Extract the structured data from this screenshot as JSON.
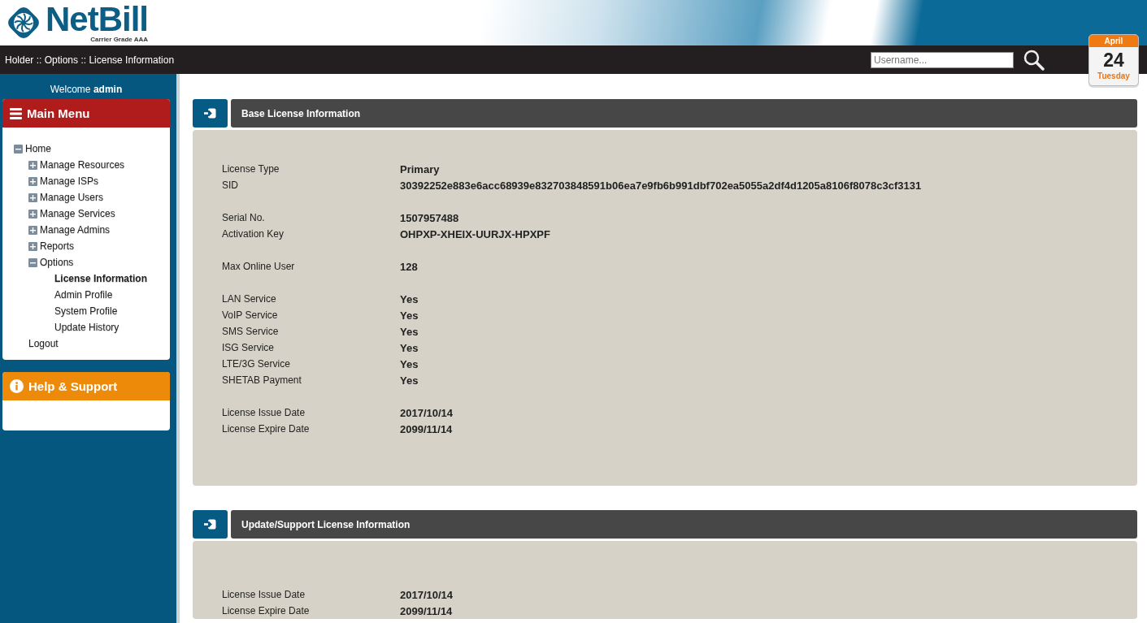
{
  "logo": {
    "name": "NetBill",
    "tagline": "Carrier Grade AAA"
  },
  "breadcrumb": "Holder :: Options :: License Information",
  "search": {
    "placeholder": "Username..."
  },
  "calendar": {
    "month": "April",
    "day": "24",
    "weekday": "Tuesday"
  },
  "sidebar": {
    "welcome": "Welcome **admin**",
    "main_menu": {
      "title": "Main Menu",
      "items": [
        {
          "label": "Home",
          "expanded": true,
          "selected": false,
          "children": [
            {
              "label": "Manage Resources",
              "expanded": false,
              "selected": false
            },
            {
              "label": "Manage ISPs",
              "expanded": false,
              "selected": false
            },
            {
              "label": "Manage Users",
              "expanded": false,
              "selected": false
            },
            {
              "label": "Manage Services",
              "expanded": false,
              "selected": false
            },
            {
              "label": "Manage Admins",
              "expanded": false,
              "selected": false
            },
            {
              "label": "Reports",
              "expanded": false,
              "selected": false
            },
            {
              "label": "Options",
              "expanded": true,
              "selected": false,
              "children": [
                {
                  "label": "License Information",
                  "selected": true
                },
                {
                  "label": "Admin Profile",
                  "selected": false
                },
                {
                  "label": "System Profile",
                  "selected": false
                },
                {
                  "label": "Update History",
                  "selected": false
                }
              ]
            },
            {
              "label": "Logout",
              "selected": false
            }
          ]
        }
      ]
    },
    "help": {
      "title": "Help & Support"
    }
  },
  "panels": [
    {
      "title": "Base License Information",
      "groups": [
        [
          {
            "label": "License Type",
            "value": "Primary"
          },
          {
            "label": "SID",
            "value": "30392252e883e6acc68939e832703848591b06ea7e9fb6b991dbf702ea5055a2df4d1205a8106f8078c3cf3131"
          }
        ],
        [
          {
            "label": "Serial No.",
            "value": "1507957488"
          },
          {
            "label": "Activation Key",
            "value": "OHPXP-XHEIX-UURJX-HPXPF"
          }
        ],
        [
          {
            "label": "Max Online User",
            "value": "128"
          }
        ],
        [
          {
            "label": "LAN Service",
            "value": "Yes"
          },
          {
            "label": "VoIP Service",
            "value": "Yes"
          },
          {
            "label": "SMS Service",
            "value": "Yes"
          },
          {
            "label": "ISG Service",
            "value": "Yes"
          },
          {
            "label": "LTE/3G Service",
            "value": "Yes"
          },
          {
            "label": "SHETAB Payment",
            "value": "Yes"
          }
        ],
        [
          {
            "label": "License Issue Date",
            "value": "2017/10/14"
          },
          {
            "label": "License Expire Date",
            "value": "2099/11/14"
          }
        ]
      ]
    },
    {
      "title": "Update/Support License Information",
      "groups": [
        [
          {
            "label": "License Issue Date",
            "value": "2017/10/14"
          },
          {
            "label": "License Expire Date",
            "value": "2099/11/14"
          }
        ]
      ]
    }
  ]
}
